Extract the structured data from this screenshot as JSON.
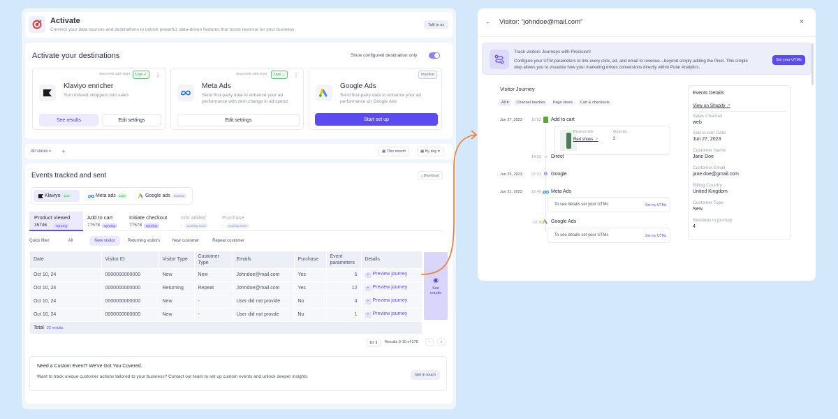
{
  "colors": {
    "accent": "#5b4cf2",
    "background": "#d4e8fb",
    "green": "#2e9e4f",
    "orange": "#f07a2b"
  },
  "activate": {
    "title": "Activate",
    "subtitle": "Connect your data sources and destinations to unlock powerful, data-driven features that boost revenue for your business",
    "talk_button": "Talk to us"
  },
  "destinations": {
    "title": "Activate your destinations",
    "toggle_label": "Show configured destination only",
    "toggle_on": true,
    "cards": [
      {
        "since": "Since Feb 13th 2024",
        "status": "Live",
        "name": "Klaviyo enricher",
        "desc": "Turn missed shoppers into sales",
        "btn1": "See results",
        "btn2": "Edit settings",
        "icon": "klaviyo-logo"
      },
      {
        "since": "Since Feb 13th 2024",
        "status": "Live",
        "name": "Meta Ads",
        "desc": "Send first-party data to enhance your ad performance with zero change in ad spend",
        "btn1": "Edit settings",
        "icon": "meta-logo"
      },
      {
        "status": "Inactive",
        "name": "Google Ads",
        "desc": "Send first-party data to enhance your ad performance on Google Ads",
        "btn1": "Start set up",
        "icon": "google-ads-logo"
      }
    ]
  },
  "filters": {
    "stores": "All stores",
    "date": "This month",
    "group": "By day"
  },
  "events": {
    "title": "Events tracked and sent",
    "download": "Download",
    "tabs": [
      {
        "label": "Klaviyo",
        "badge": "Live"
      },
      {
        "label": "Meta ads",
        "badge": "Live"
      },
      {
        "label": "Google ads",
        "badge": "Inactive"
      }
    ],
    "metrics": [
      {
        "label": "Product viewed",
        "value": "35746",
        "badge": "Syncing"
      },
      {
        "label": "Add to cart",
        "value": "77578",
        "badge": "Syncing"
      },
      {
        "label": "Initiate checkout",
        "value": "77578",
        "badge": "Syncing"
      },
      {
        "label": "Info added",
        "value": "-",
        "badge": "Coming soon"
      },
      {
        "label": "Purchase",
        "value": "-",
        "badge": "Coming soon"
      }
    ],
    "quick_filter_label": "Quick filter:",
    "quick_filters": [
      "All",
      "New visitor",
      "Returning visitors",
      "New customer",
      "Repeat customer"
    ],
    "columns": [
      "Date",
      "Visitor ID",
      "Visitor Type",
      "Customer Type",
      "Emails",
      "Purchase",
      "Event parameters",
      "Details"
    ],
    "rows": [
      {
        "date": "Oct 10, 24",
        "visitor_id": "0000000000000",
        "visitor_type": "New",
        "customer_type": "New",
        "email": "Johndoe@mail.com",
        "purchase": "Yes",
        "params": "5",
        "details": "Preview journey"
      },
      {
        "date": "Oct 10, 24",
        "visitor_id": "0000000000000",
        "visitor_type": "Returning",
        "customer_type": "Repeat",
        "email": "Johndoe@mail.com",
        "purchase": "Yes",
        "params": "12",
        "details": "Preview journey"
      },
      {
        "date": "Oct 10, 24",
        "visitor_id": "0000000000000",
        "visitor_type": "New",
        "customer_type": "-",
        "email": "User did not provide",
        "purchase": "No",
        "params": "4",
        "details": "Preview journey"
      },
      {
        "date": "Oct 10, 24",
        "visitor_id": "0000000000000",
        "visitor_type": "New",
        "customer_type": "-",
        "email": "User did not provde",
        "purchase": "No",
        "params": "1",
        "details": "Preview journey"
      }
    ],
    "total_label": "Total",
    "total_value": "22 results",
    "see_results": "See results",
    "page_size": "10",
    "results_text": "Results 0-10 of 278",
    "custom_title": "Need a Custom Event? We've Got You Covered.",
    "custom_desc": "Want to track unique customer actions tailored to your business? Contact our team to set up custom events and unlock deeper insights",
    "get_in_touch": "Get in touch"
  },
  "visitor": {
    "title": "Visitor: “johndoe@mail.com”",
    "banner_title": "Track visitors Journeys with Precision!",
    "banner_desc": "Configure your UTM parameters to link every click, ad, and email to revenue—beyond simply adding the Pixel. This simple step allows you to visualize how your marketing drives conversions directly within Polar Analytics.",
    "set_utms": "Set your UTMs",
    "journey_title": "Visitor Journey",
    "journey_filters": [
      "All",
      "Channel touches",
      "Page views",
      "Cart & checkouts"
    ],
    "journey": {
      "e1_date": "Jun 27, 2023",
      "e1_time": "16:02",
      "e1_label": "Add to cart",
      "product_title_label": "Product title",
      "product_title": "Red shoes",
      "quantity_label": "Quantity",
      "quantity": "2",
      "e2_time": "14:23",
      "e2_label": "Direct",
      "e3_date": "Jun 25, 2023",
      "e3_time": "07:33",
      "e3_label": "Google",
      "e4_date": "Jun 21, 2023",
      "e4_time": "22:46",
      "e4_label": "Meta Ads",
      "utm_text": "To see details set your UTMs",
      "utm_link": "Set my UTMs",
      "e5_time": "10:18",
      "e5_label": "Google Ads"
    },
    "details_title": "Events Details",
    "shopify_link": "View on Shopify",
    "fields": [
      {
        "label": "Sales Channel",
        "value": "web"
      },
      {
        "label": "Add to cart Date",
        "value": "Jun 27, 2023"
      },
      {
        "label": "Customer Name",
        "value": "Jane Doe"
      },
      {
        "label": "Customer Email",
        "value": "jane.doe@gmail.com"
      },
      {
        "label": "Billing Country",
        "value": "United Kingdom"
      },
      {
        "label": "Customer Type",
        "value": "New"
      },
      {
        "label": "Sessions in journey",
        "value": "4"
      }
    ]
  }
}
